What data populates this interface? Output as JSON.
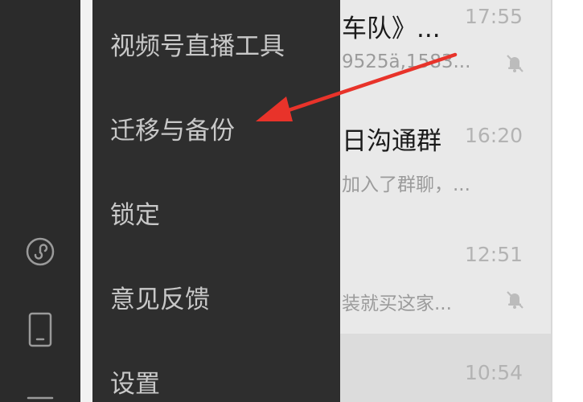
{
  "menu": {
    "items": [
      {
        "label": "视频号直播工具"
      },
      {
        "label": "迁移与备份"
      },
      {
        "label": "锁定"
      },
      {
        "label": "意见反馈"
      },
      {
        "label": "设置"
      }
    ]
  },
  "chats": [
    {
      "name": "车队》...",
      "preview": "9525ä,1583...",
      "time": "17:55",
      "muted": true
    },
    {
      "name": "日沟通群",
      "preview": "加入了群聊，...",
      "time": "16:20",
      "muted": false
    },
    {
      "name": "",
      "preview": "装就买这家...",
      "time": "12:51",
      "muted": true
    },
    {
      "name": "",
      "preview": "",
      "time": "10:54",
      "muted": false
    }
  ],
  "sidebar": {
    "icons": [
      "mini-program-icon",
      "phone-icon",
      "menu-icon"
    ]
  },
  "annotation": {
    "color": "#e8332a"
  }
}
